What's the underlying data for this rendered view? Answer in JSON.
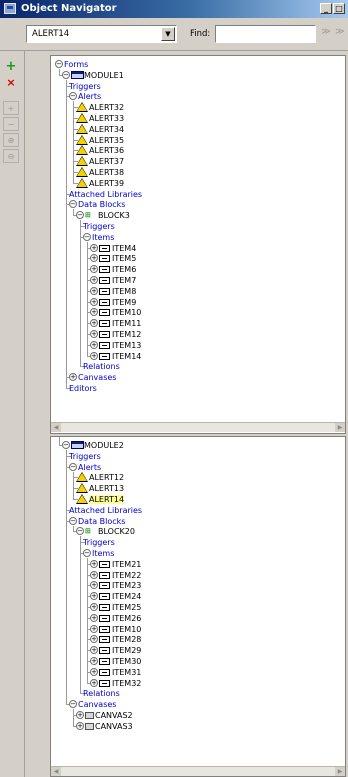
{
  "window": {
    "title": "Object Navigator",
    "min_glyph": "_",
    "max_glyph": "□"
  },
  "toolbar": {
    "combo_value": "ALERT14",
    "find_label": "Find:",
    "find_value": ""
  },
  "lefttoolbar": {
    "create_glyph": "+",
    "delete_glyph": "×",
    "expand_glyph": "+",
    "collapse_glyph": "−",
    "expand_all_glyph": "⊕",
    "collapse_all_glyph": "⊖"
  },
  "pane1": {
    "rows": [
      {
        "label": "Forms",
        "level": 0,
        "toggle": "−",
        "icon": "",
        "color": "hdr"
      },
      {
        "label": "MODULE1",
        "level": 1,
        "toggle": "−",
        "icon": "module",
        "color": ""
      },
      {
        "label": "Triggers",
        "level": 2,
        "toggle": "",
        "icon": "",
        "color": "hdr"
      },
      {
        "label": "Alerts",
        "level": 2,
        "toggle": "−",
        "icon": "",
        "color": "hdr"
      },
      {
        "label": "ALERT32",
        "level": 3,
        "toggle": "",
        "icon": "alert",
        "color": ""
      },
      {
        "label": "ALERT33",
        "level": 3,
        "toggle": "",
        "icon": "alert",
        "color": ""
      },
      {
        "label": "ALERT34",
        "level": 3,
        "toggle": "",
        "icon": "alert",
        "color": ""
      },
      {
        "label": "ALERT35",
        "level": 3,
        "toggle": "",
        "icon": "alert",
        "color": ""
      },
      {
        "label": "ALERT36",
        "level": 3,
        "toggle": "",
        "icon": "alert",
        "color": ""
      },
      {
        "label": "ALERT37",
        "level": 3,
        "toggle": "",
        "icon": "alert",
        "color": ""
      },
      {
        "label": "ALERT38",
        "level": 3,
        "toggle": "",
        "icon": "alert",
        "color": ""
      },
      {
        "label": "ALERT39",
        "level": 3,
        "toggle": "",
        "icon": "alert",
        "color": ""
      },
      {
        "label": "Attached Libraries",
        "level": 2,
        "toggle": "",
        "icon": "",
        "color": "hdr"
      },
      {
        "label": "Data Blocks",
        "level": 2,
        "toggle": "−",
        "icon": "",
        "color": "hdr"
      },
      {
        "label": "BLOCK3",
        "level": 3,
        "toggle": "−",
        "icon": "block",
        "color": ""
      },
      {
        "label": "Triggers",
        "level": 4,
        "toggle": "",
        "icon": "",
        "color": "hdr"
      },
      {
        "label": "Items",
        "level": 4,
        "toggle": "−",
        "icon": "",
        "color": "hdr"
      },
      {
        "label": "ITEM4",
        "level": 5,
        "toggle": "+",
        "icon": "item",
        "color": ""
      },
      {
        "label": "ITEM5",
        "level": 5,
        "toggle": "+",
        "icon": "item",
        "color": ""
      },
      {
        "label": "ITEM6",
        "level": 5,
        "toggle": "+",
        "icon": "item",
        "color": ""
      },
      {
        "label": "ITEM7",
        "level": 5,
        "toggle": "+",
        "icon": "item",
        "color": ""
      },
      {
        "label": "ITEM8",
        "level": 5,
        "toggle": "+",
        "icon": "item",
        "color": ""
      },
      {
        "label": "ITEM9",
        "level": 5,
        "toggle": "+",
        "icon": "item",
        "color": ""
      },
      {
        "label": "ITEM10",
        "level": 5,
        "toggle": "+",
        "icon": "item",
        "color": ""
      },
      {
        "label": "ITEM11",
        "level": 5,
        "toggle": "+",
        "icon": "item",
        "color": ""
      },
      {
        "label": "ITEM12",
        "level": 5,
        "toggle": "+",
        "icon": "item",
        "color": ""
      },
      {
        "label": "ITEM13",
        "level": 5,
        "toggle": "+",
        "icon": "item",
        "color": ""
      },
      {
        "label": "ITEM14",
        "level": 5,
        "toggle": "+",
        "icon": "item",
        "color": ""
      },
      {
        "label": "Relations",
        "level": 4,
        "toggle": "",
        "icon": "",
        "color": "hdr"
      },
      {
        "label": "Canvases",
        "level": 2,
        "toggle": "+",
        "icon": "",
        "color": "hdr"
      },
      {
        "label": "Editors",
        "level": 2,
        "toggle": "",
        "icon": "",
        "color": "hdr"
      }
    ]
  },
  "pane2": {
    "rows": [
      {
        "label": "MODULE2",
        "level": 1,
        "toggle": "−",
        "icon": "module",
        "color": ""
      },
      {
        "label": "Triggers",
        "level": 2,
        "toggle": "",
        "icon": "",
        "color": "hdr"
      },
      {
        "label": "Alerts",
        "level": 2,
        "toggle": "−",
        "icon": "",
        "color": "hdr"
      },
      {
        "label": "ALERT12",
        "level": 3,
        "toggle": "",
        "icon": "alert",
        "color": ""
      },
      {
        "label": "ALERT13",
        "level": 3,
        "toggle": "",
        "icon": "alert",
        "color": ""
      },
      {
        "label": "ALERT14",
        "level": 3,
        "toggle": "",
        "icon": "alert",
        "color": "sel"
      },
      {
        "label": "Attached Libraries",
        "level": 2,
        "toggle": "",
        "icon": "",
        "color": "hdr"
      },
      {
        "label": "Data Blocks",
        "level": 2,
        "toggle": "−",
        "icon": "",
        "color": "hdr"
      },
      {
        "label": "BLOCK20",
        "level": 3,
        "toggle": "−",
        "icon": "block",
        "color": ""
      },
      {
        "label": "Triggers",
        "level": 4,
        "toggle": "",
        "icon": "",
        "color": "hdr"
      },
      {
        "label": "Items",
        "level": 4,
        "toggle": "−",
        "icon": "",
        "color": "hdr"
      },
      {
        "label": "ITEM21",
        "level": 5,
        "toggle": "+",
        "icon": "item",
        "color": ""
      },
      {
        "label": "ITEM22",
        "level": 5,
        "toggle": "+",
        "icon": "item",
        "color": ""
      },
      {
        "label": "ITEM23",
        "level": 5,
        "toggle": "+",
        "icon": "item",
        "color": ""
      },
      {
        "label": "ITEM24",
        "level": 5,
        "toggle": "+",
        "icon": "item",
        "color": ""
      },
      {
        "label": "ITEM25",
        "level": 5,
        "toggle": "+",
        "icon": "item",
        "color": ""
      },
      {
        "label": "ITEM26",
        "level": 5,
        "toggle": "+",
        "icon": "item",
        "color": ""
      },
      {
        "label": "ITEM10",
        "level": 5,
        "toggle": "+",
        "icon": "item",
        "color": ""
      },
      {
        "label": "ITEM28",
        "level": 5,
        "toggle": "+",
        "icon": "item",
        "color": ""
      },
      {
        "label": "ITEM29",
        "level": 5,
        "toggle": "+",
        "icon": "item",
        "color": ""
      },
      {
        "label": "ITEM30",
        "level": 5,
        "toggle": "+",
        "icon": "item",
        "color": ""
      },
      {
        "label": "ITEM31",
        "level": 5,
        "toggle": "+",
        "icon": "item",
        "color": ""
      },
      {
        "label": "ITEM32",
        "level": 5,
        "toggle": "+",
        "icon": "item",
        "color": ""
      },
      {
        "label": "Relations",
        "level": 4,
        "toggle": "",
        "icon": "",
        "color": "hdr"
      },
      {
        "label": "Canvases",
        "level": 2,
        "toggle": "−",
        "icon": "",
        "color": "hdr"
      },
      {
        "label": "CANVAS2",
        "level": 3,
        "toggle": "+",
        "icon": "canvas",
        "color": ""
      },
      {
        "label": "CANVAS3",
        "level": 3,
        "toggle": "+",
        "icon": "canvas",
        "color": ""
      }
    ]
  }
}
